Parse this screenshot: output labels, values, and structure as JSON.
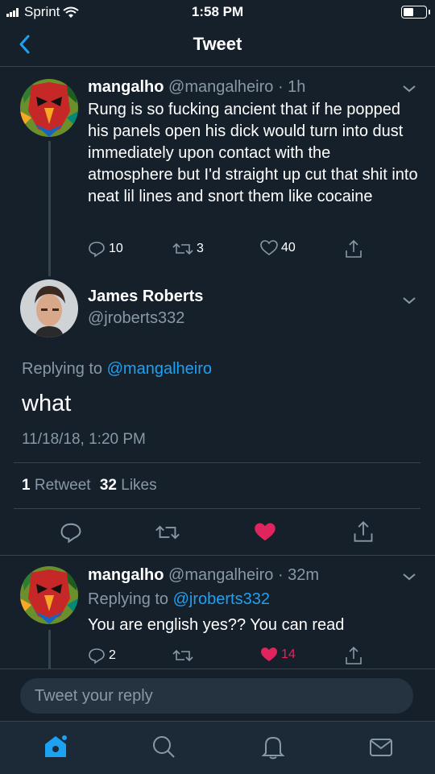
{
  "status_bar": {
    "carrier": "Sprint",
    "time": "1:58 PM"
  },
  "nav": {
    "title": "Tweet"
  },
  "tweet_parent": {
    "username": "mangalho",
    "handle": "@mangalheiro",
    "time": "· 1h",
    "text": "Rung is so fucking ancient that if he popped his panels open his dick would turn into dust immediately upon contact with the atmosphere but I'd straight up cut that shit into neat lil lines and snort them like cocaine",
    "replies": "10",
    "retweets": "3",
    "likes": "40"
  },
  "tweet_main": {
    "username": "James Roberts",
    "handle": "@jroberts332",
    "replying_prefix": "Replying to",
    "replying_to": "@mangalheiro",
    "text": "what",
    "timestamp": "11/18/18, 1:20 PM",
    "retweet_count": "1",
    "retweet_label": "Retweet",
    "like_count": "32",
    "like_label": "Likes"
  },
  "tweet_reply": {
    "username": "mangalho",
    "handle": "@mangalheiro",
    "time": "· 32m",
    "replying_prefix": "Replying to",
    "replying_to": "@jroberts332",
    "text": "You are english yes?? You can read",
    "replies": "2",
    "likes": "14"
  },
  "reply_box": {
    "placeholder": "Tweet your reply"
  },
  "tabs": [
    "home-icon",
    "search-icon",
    "notifications-icon",
    "messages-icon"
  ],
  "colors": {
    "background": "#15202b",
    "accent": "#1da1f2",
    "like": "#e0245e",
    "muted": "#8899a6"
  }
}
